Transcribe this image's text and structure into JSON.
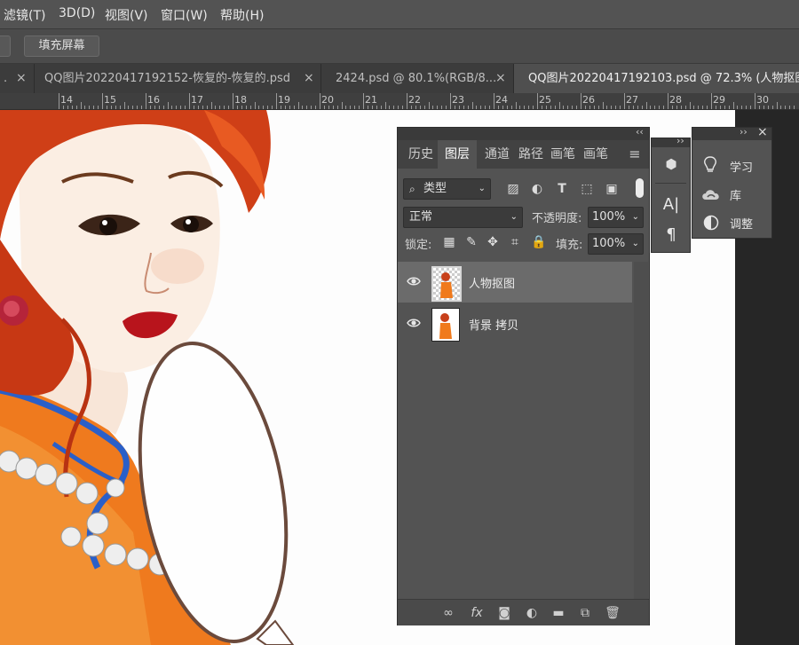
{
  "menubar": {
    "items": [
      "滤镜(T)",
      "3D(D)",
      "视图(V)",
      "窗口(W)",
      "帮助(H)"
    ]
  },
  "options_bar": {
    "fill_screen_button": "填充屏幕"
  },
  "doc_tabs": [
    {
      "title": "QQ图片20220417192152-恢复的-恢复的.psd",
      "active": false
    },
    {
      "title": "2424.psd @ 80.1%(RGB/8...",
      "active": false
    },
    {
      "title": "QQ图片20220417192103.psd @ 72.3% (人物抠图",
      "active": true
    }
  ],
  "ruler": {
    "labels": [
      "14",
      "15",
      "16",
      "17",
      "18",
      "19",
      "20",
      "21",
      "22",
      "23",
      "24",
      "25",
      "26",
      "27",
      "28",
      "29",
      "30"
    ]
  },
  "layers_panel": {
    "tabs": [
      {
        "label": "历史",
        "active": false
      },
      {
        "label": "图层",
        "active": true
      },
      {
        "label": "通道",
        "active": false
      },
      {
        "label": "路径",
        "active": false
      },
      {
        "label": "画笔",
        "active": false
      },
      {
        "label": "画笔",
        "active": false
      }
    ],
    "filter_kind": "类型",
    "blend_mode": "正常",
    "opacity_label": "不透明度:",
    "opacity_value": "100%",
    "lock_label": "锁定:",
    "fill_label": "填充:",
    "fill_value": "100%",
    "layers": [
      {
        "name": "人物抠图",
        "selected": true,
        "visible": true
      },
      {
        "name": "背景 拷贝",
        "selected": false,
        "visible": true
      }
    ]
  },
  "side_panel": {
    "items": [
      {
        "label": "学习",
        "icon": "lightbulb-icon"
      },
      {
        "label": "库",
        "icon": "cloud-libraries-icon"
      },
      {
        "label": "调整",
        "icon": "adjustments-icon"
      }
    ]
  },
  "colors": {
    "ui_dark": "#535353",
    "canvas": "#fdfdfd",
    "hair": "#c8401a",
    "dress": "#f07a1c",
    "lips": "#b8141c"
  }
}
